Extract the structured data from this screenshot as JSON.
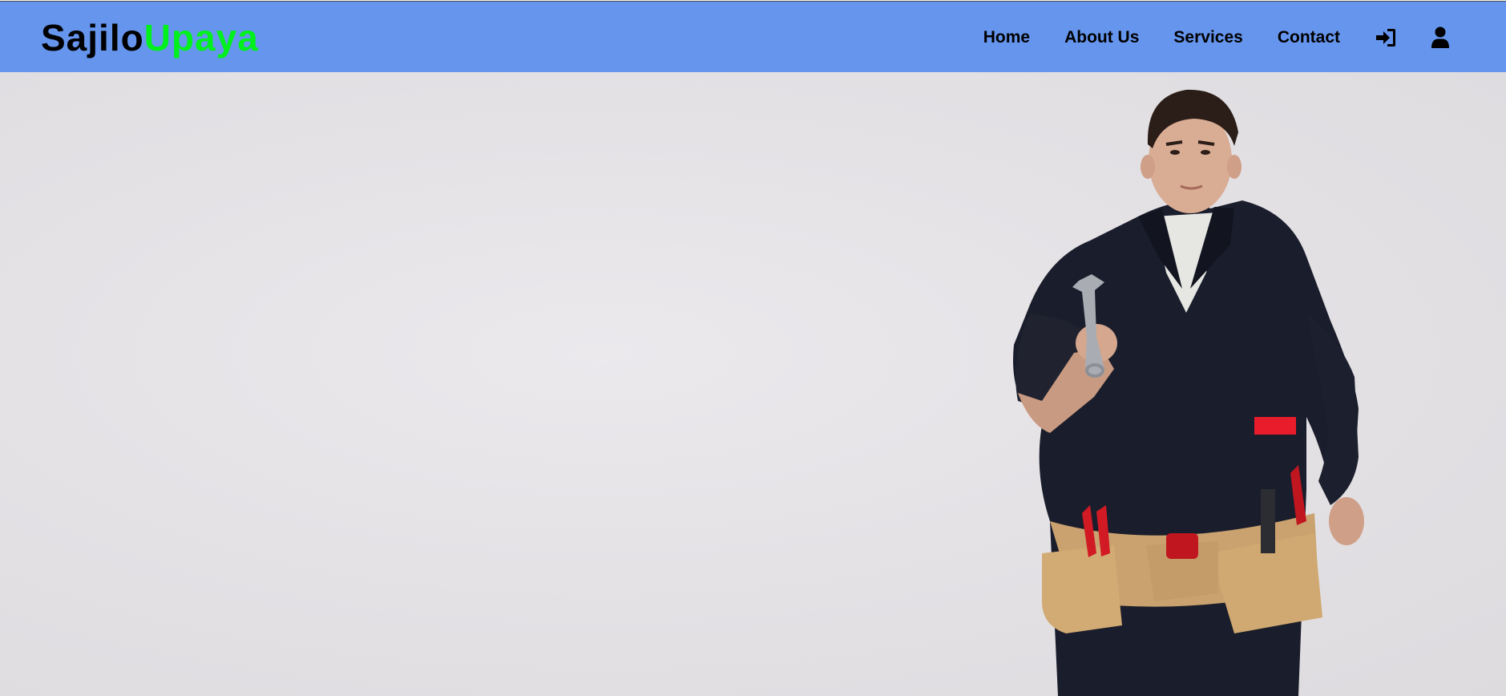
{
  "brand": {
    "part_a": "Sajilo",
    "part_b": "Upaya",
    "color_a": "#000000",
    "color_b": "#00f01c"
  },
  "navbar": {
    "background": "#6595ed",
    "links": [
      {
        "label": "Home"
      },
      {
        "label": "About Us"
      },
      {
        "label": "Services"
      },
      {
        "label": "Contact"
      }
    ],
    "icons": [
      "sign-in-icon",
      "user-icon"
    ]
  },
  "hero": {
    "image": "worker-with-wrench-and-tool-belt"
  }
}
